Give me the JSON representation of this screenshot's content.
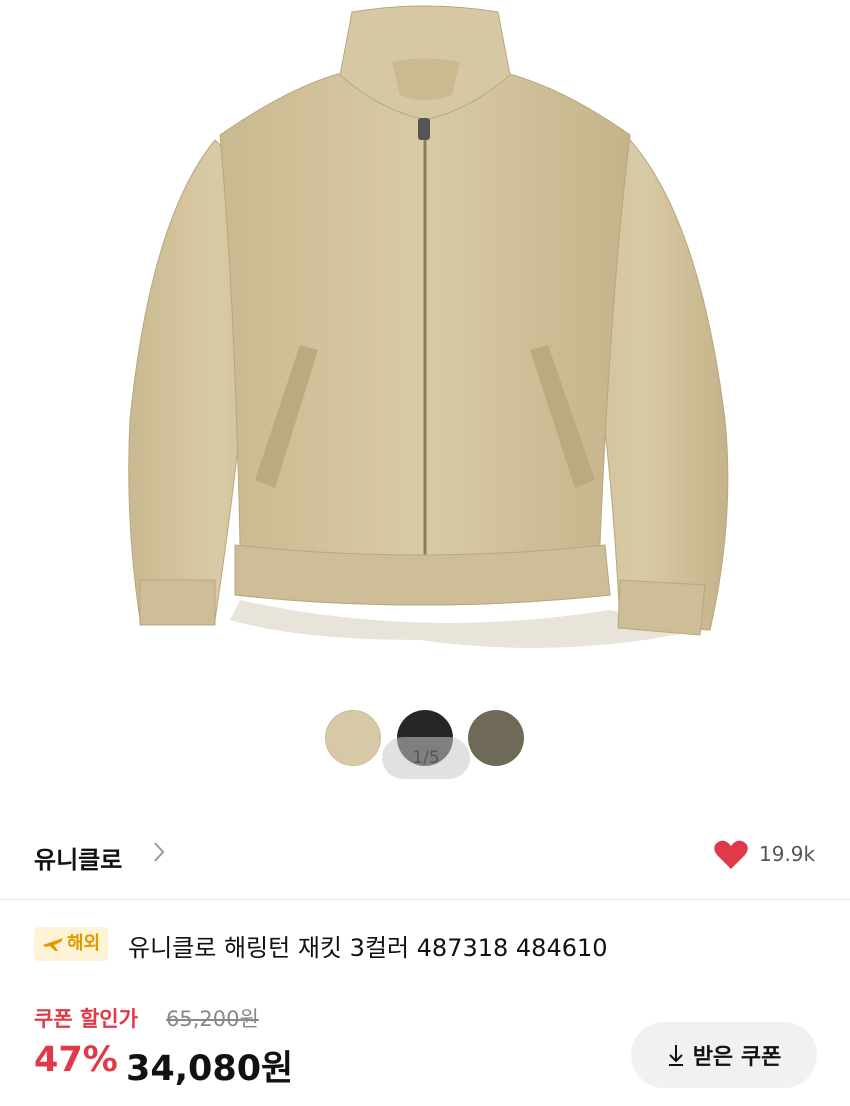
{
  "product_image": {
    "subject": "beige harrington jacket"
  },
  "color_swatches": [
    {
      "name": "beige",
      "color": "#d8c9a6"
    },
    {
      "name": "black",
      "color": "#262626"
    },
    {
      "name": "olive",
      "color": "#6f6a57"
    }
  ],
  "pager": {
    "text": "1/5"
  },
  "brand": {
    "name": "유니클로",
    "chevron_icon": "chevron-right-icon"
  },
  "likes": {
    "icon": "heart-icon",
    "count": "19.9k",
    "color": "#e0394a"
  },
  "product": {
    "badge": {
      "icon": "airplane-icon",
      "label": "해외"
    },
    "title": "유니클로 해링턴 재킷 3컬러 487318 484610"
  },
  "pricing": {
    "coupon_label": "쿠폰 할인가",
    "original_price": "65,200원",
    "discount_rate": "47%",
    "sale_price": "34,080원"
  },
  "coupon_button": {
    "icon": "download-icon",
    "label": "받은 쿠폰"
  }
}
